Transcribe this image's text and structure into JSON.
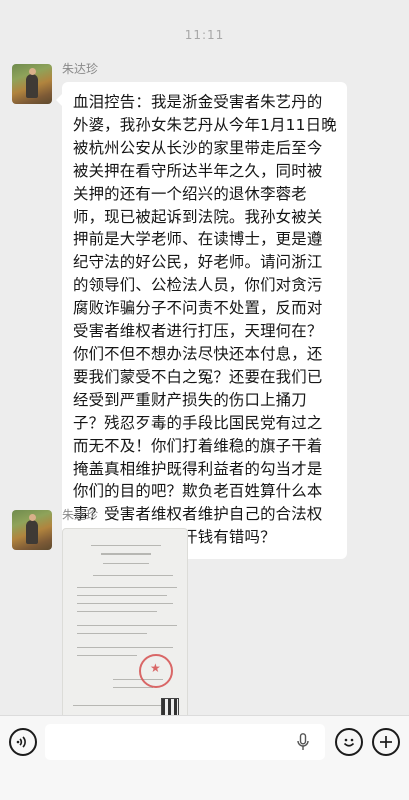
{
  "status_time": "11:11",
  "messages": [
    {
      "sender": "朱达珍",
      "text": "血泪控告：我是浙金受害者朱艺丹的外婆，我孙女朱艺丹从今年1月11日晚被杭州公安从长沙的家里带走后至今被关押在看守所达半年之久，同时被关押的还有一个绍兴的退休李蓉老师，现已被起诉到法院。我孙女被关押前是大学老师、在读博士，更是遵纪守法的好公民，好老师。请问浙江的领导们、公检法人员，你们对贪污腐败诈骗分子不问责不处置，反而对受害者维权者进行打压，天理何在？你们不但不想办法尽快还本付息，还要我们蒙受不白之冤？还要在我们已经受到严重财产损失的伤口上捅刀子？残忍歹毒的手段比国民党有过之而无不及！你们打着维稳的旗子干着掩盖真相维护既得利益者的勾当才是你们的目的吧？欺负老百姓算什么本事？受害者维权者维护自己的合法权益拿回自己的血汗钱有错吗？"
    },
    {
      "sender": "朱达珍",
      "image_type": "document-photo"
    }
  ],
  "input_bar": {
    "placeholder": "",
    "icons": [
      "voice-icon",
      "microphone-icon",
      "emoji-icon",
      "plus-icon"
    ]
  }
}
